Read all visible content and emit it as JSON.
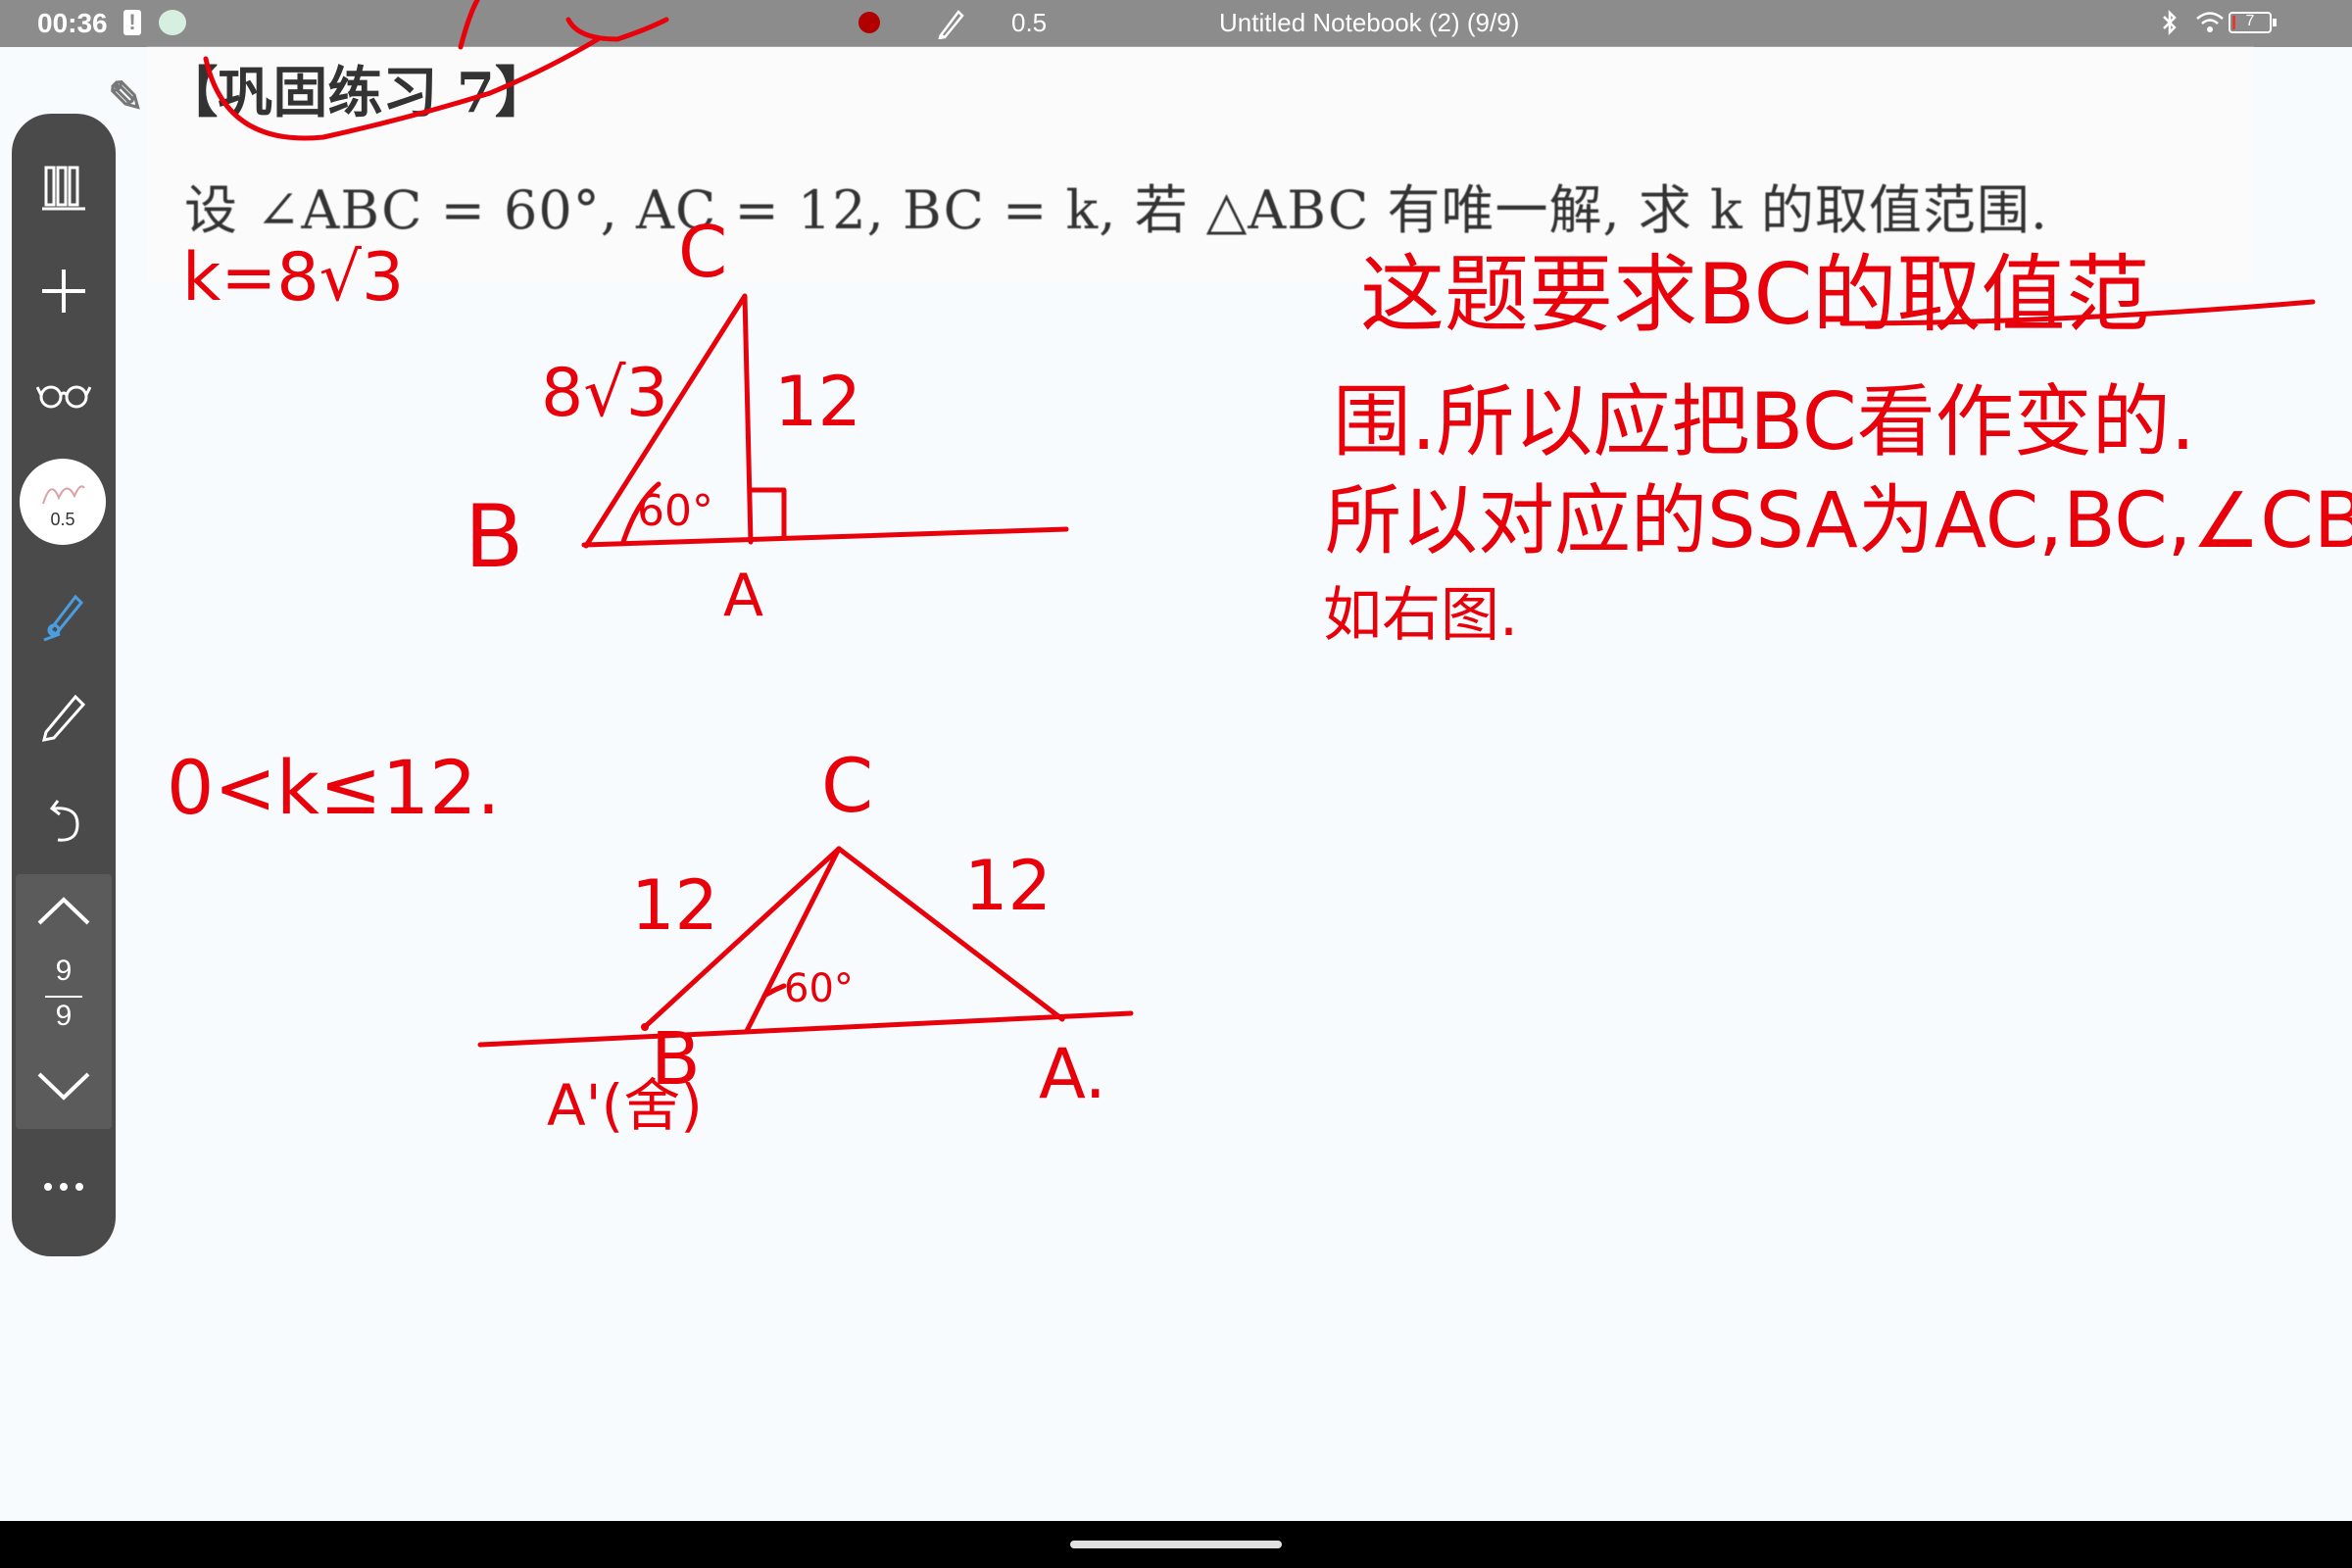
{
  "status_bar": {
    "time": "00:36",
    "pen_width": "0.5",
    "title": "Untitled Notebook (2) (9/9)",
    "battery": "7",
    "battery_level_percent": 7,
    "record_color": "#b00000"
  },
  "printed": {
    "section_title": "【巩固练习 7】",
    "problem": "设 ∠ABC = 60°, AC = 12, BC = k, 若 △ABC 有唯一解, 求 k 的取值范围."
  },
  "toolbar": {
    "pen_width": "0.5",
    "page_current": "9",
    "page_total": "9",
    "icons": [
      "library-icon",
      "add-icon",
      "glasses-icon",
      "pen-width-icon",
      "highlighter-icon",
      "pencil-icon",
      "undo-icon",
      "page-up-icon",
      "page-down-icon",
      "more-icon"
    ]
  },
  "ink": {
    "color": "#e8000b",
    "k_eq": "k=8√3",
    "answer": "0<k≤12.",
    "note_line1": "这题要求BC的取值范",
    "note_line2": "围.所以应把BC看作变的.",
    "note_line3": "所以对应的SSA为AC,BC,∠CBA.",
    "note_line4": "如右图.",
    "fig1": {
      "label_c": "C",
      "label_b": "B",
      "label_a": "A",
      "side_bc": "8√3",
      "side_ac": "12",
      "angle": "60°"
    },
    "fig2": {
      "label_c": "C",
      "label_b": "B",
      "label_a": "A.",
      "label_a_prime": "A'(舍)",
      "side_left": "12",
      "side_right": "12",
      "angle": "60°"
    }
  }
}
